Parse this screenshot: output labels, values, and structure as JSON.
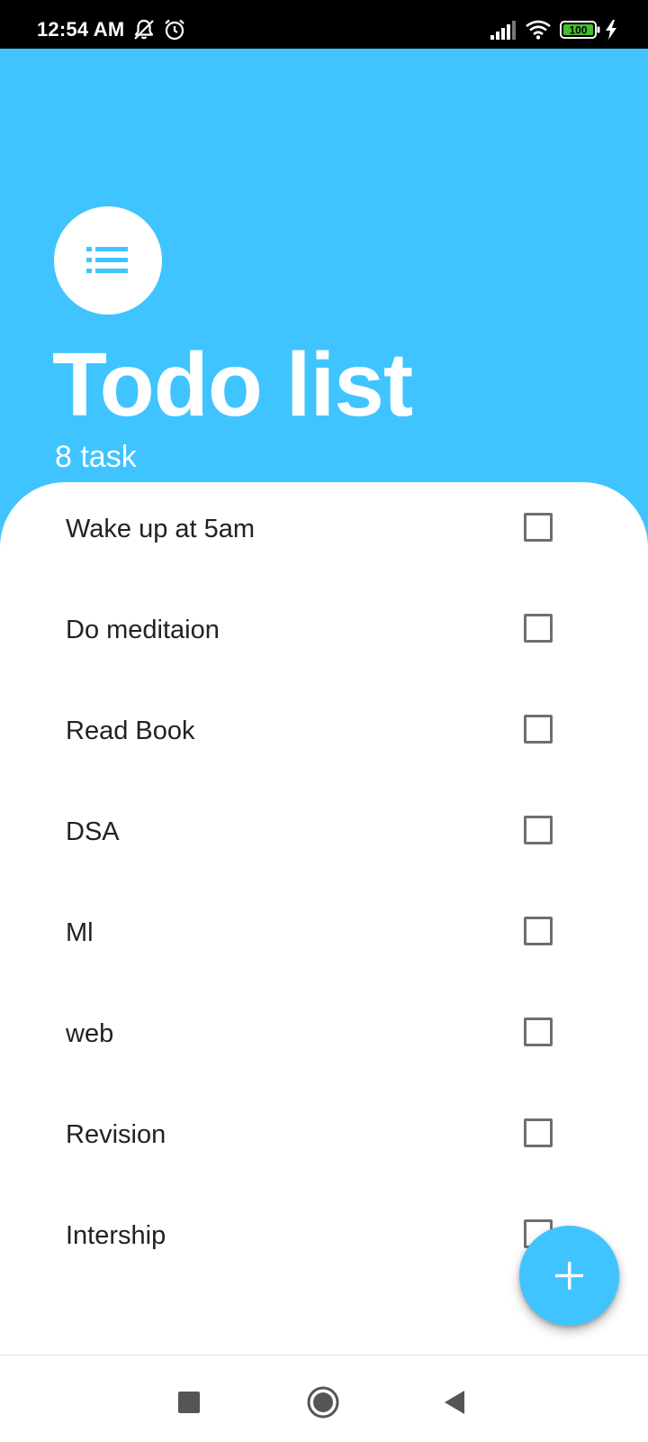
{
  "status_bar": {
    "time": "12:54 AM",
    "battery": "100",
    "icons": [
      "mute-notifications-icon",
      "alarm-icon",
      "signal-icon",
      "wifi-icon",
      "battery-icon",
      "charging-icon"
    ]
  },
  "header": {
    "icon": "list-icon",
    "title": "Todo list",
    "subtitle": "8 task"
  },
  "tasks": [
    {
      "label": "Wake up at 5am",
      "checked": false
    },
    {
      "label": "Do meditaion",
      "checked": false
    },
    {
      "label": "Read Book",
      "checked": false
    },
    {
      "label": "DSA",
      "checked": false
    },
    {
      "label": "Ml",
      "checked": false
    },
    {
      "label": "web",
      "checked": false
    },
    {
      "label": "Revision",
      "checked": false
    },
    {
      "label": "Intership",
      "checked": false
    }
  ],
  "fab": {
    "icon": "plus-icon"
  },
  "nav_bar": {
    "icons": [
      "recents-square-icon",
      "home-circle-icon",
      "back-triangle-icon"
    ]
  },
  "colors": {
    "accent": "#40c4ff",
    "status_bar": "#000000",
    "text": "#222222",
    "checkbox_border": "#6f6f6f"
  }
}
